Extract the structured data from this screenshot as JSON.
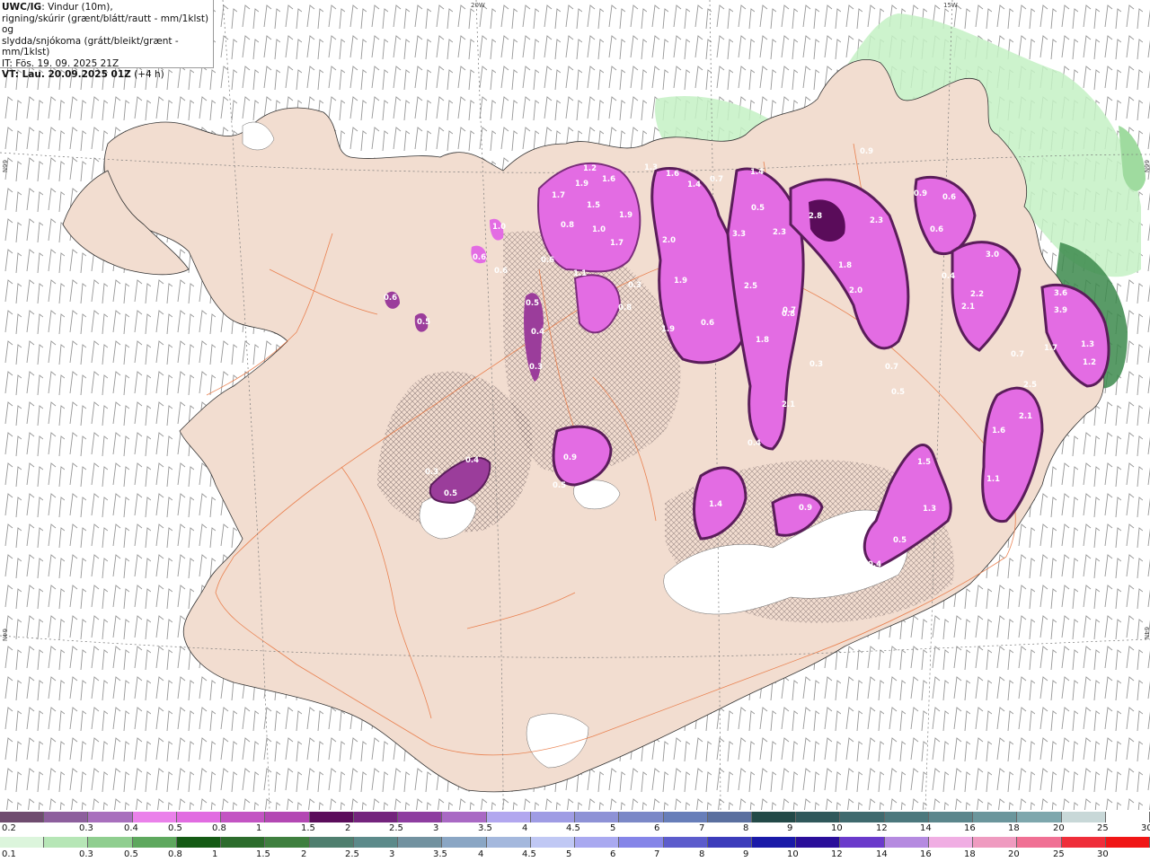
{
  "header": {
    "source": "UWC/IG",
    "line1_rest": ": Vindur (10m),",
    "line2": "rigning/skúrir (grænt/blátt/rautt - mm/1klst) og",
    "line3": "slydda/snjókoma (grátt/bleikt/grænt - mm/1klst)",
    "it_line": "IT: Fös. 19. 09. 2025 21Z",
    "vt_label": "VT: Lau. 20.09.2025 01Z",
    "vt_offset": " (+4 h)"
  },
  "coords": {
    "lon_20w": "20W",
    "lon_15w": "15W",
    "lat_66n_left": "66N",
    "lat_66n_right": "66N",
    "lat_64n_left": "64N",
    "lat_64n_right": "64N"
  },
  "colors": {
    "land": "#f2ddd0",
    "sea": "#ffffff",
    "roads": "#e8713a",
    "precip_pink": "#e36ce3",
    "precip_purple": "#9b3d9b",
    "precip_dark": "#5a1d5a",
    "rain_green_light": "#b8f0b8",
    "rain_green_dark": "#2f7a3f"
  },
  "precip_labels": [
    "1.2",
    "1.7",
    "1.9",
    "1.6",
    "1.5",
    "0.8",
    "1.0",
    "1.9",
    "1.7",
    "1.1",
    "1.0",
    "0.6",
    "0.6",
    "0.6",
    "0.5",
    "0.4",
    "0.3",
    "0.3",
    "0.8",
    "1.3",
    "1.6",
    "1.4",
    "0.7",
    "1.4",
    "0.5",
    "0.9",
    "2.8",
    "2.3",
    "2.0",
    "3.3",
    "2.5",
    "1.9",
    "0.6",
    "1.9",
    "1.8",
    "0.7",
    "2.3",
    "1.8",
    "2.0",
    "0.7",
    "0.5",
    "2.1",
    "0.4",
    "0.3",
    "3.0",
    "2.2",
    "2.1",
    "0.9",
    "3.6",
    "3.9",
    "1.7",
    "1.3",
    "1.2",
    "2.5",
    "2.1",
    "1.6",
    "1.1",
    "0.6",
    "0.6",
    "0.3",
    "0.4",
    "0.5",
    "0.9",
    "0.5",
    "1.4",
    "0.9",
    "1.5",
    "1.3",
    "0.5",
    "0.3",
    "0.4",
    "0.5",
    "0.7",
    "0.6",
    "0.4",
    "0.8"
  ],
  "legend_snow": {
    "colors": [
      "#6f4c6f",
      "#8d5f9d",
      "#a86fbd",
      "#ea81ea",
      "#e16ce1",
      "#c354c3",
      "#b348b3",
      "#5b0c5b",
      "#74247d",
      "#8e3da0",
      "#a969c4",
      "#b2a7ef",
      "#9f9ce4",
      "#8e92d6",
      "#7b88c7",
      "#677eb9",
      "#5a6f9f",
      "#234a48",
      "#30585b",
      "#3f6a6e",
      "#4c787d",
      "#5b868c",
      "#6b969c",
      "#7ea7ad",
      "#c8d8d8",
      "#ffffff"
    ],
    "labels": [
      "0.2",
      "0.3",
      "0.4",
      "0.5",
      "0.8",
      "1",
      "1.5",
      "2",
      "2.5",
      "3",
      "3.5",
      "4",
      "4.5",
      "5",
      "6",
      "7",
      "8",
      "9",
      "10",
      "12",
      "14",
      "16",
      "18",
      "20",
      "25",
      "30"
    ]
  },
  "legend_rain": {
    "colors": [
      "#dcf5dc",
      "#b6e6b6",
      "#8fce8f",
      "#5ea85e",
      "#145a14",
      "#2c6c2c",
      "#3f7f3f",
      "#4f7f6f",
      "#5c8a8a",
      "#7292a0",
      "#8aa6c4",
      "#a4b8dd",
      "#c0c8f4",
      "#a9a9f0",
      "#8585e8",
      "#5c5ccc",
      "#3c3cbb",
      "#1a1aa8",
      "#2a0e9a",
      "#6a3acb",
      "#b58ae0",
      "#f0aee3",
      "#ef9bc0",
      "#f07094",
      "#ef2e3a",
      "#f01616"
    ],
    "labels": [
      "0.1",
      "0.3",
      "0.5",
      "0.8",
      "1",
      "1.5",
      "2",
      "2.5",
      "3",
      "3.5",
      "4",
      "4.5",
      "5",
      "6",
      "7",
      "8",
      "9",
      "10",
      "12",
      "14",
      "16",
      "18",
      "20",
      "25",
      "30"
    ]
  }
}
